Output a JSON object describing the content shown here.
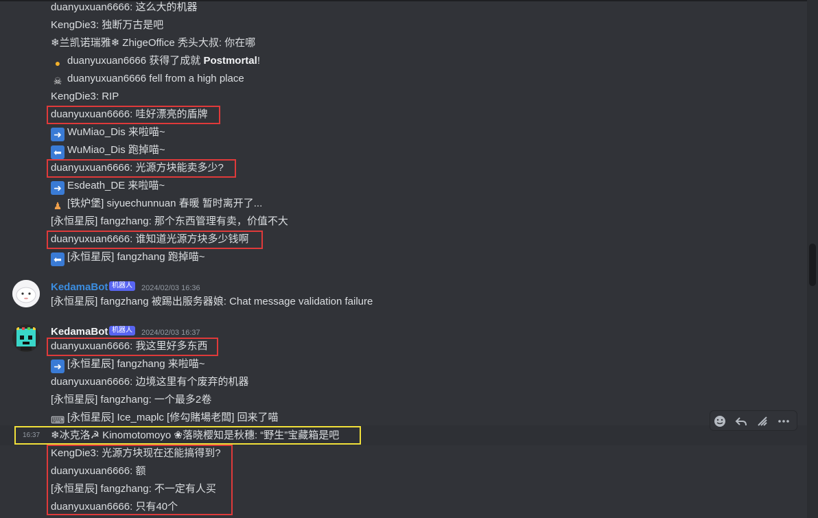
{
  "messages_top": [
    {
      "text": "duanyuxuan6666: 这么大的机器"
    },
    {
      "text": "KengDie3: 独断万古是吧"
    },
    {
      "text": "❄兰凯诺瑞雅❄ ZhigeOffice 秃头大叔: 你在哪"
    },
    {
      "icon": "medal-icon",
      "prefix": "duanyuxuan6666 获得了成就 ",
      "bold": "Postmortal",
      "suffix": "!"
    },
    {
      "icon": "skull-icon",
      "text": "duanyuxuan6666 fell from a high place"
    },
    {
      "text": "KengDie3: RIP"
    },
    {
      "text": "duanyuxuan6666: 哇好漂亮的盾牌"
    },
    {
      "icon": "join-arrow-icon",
      "text": "WuMiao_Dis 来啦喵~"
    },
    {
      "icon": "leave-arrow-icon",
      "text": "WuMiao_Dis 跑掉喵~"
    },
    {
      "text": "duanyuxuan6666: 光源方块能卖多少?"
    },
    {
      "icon": "join-arrow-icon",
      "text": "Esdeath_DE 来啦喵~"
    },
    {
      "icon": "walking-person-icon",
      "text": "[铁炉堡] siyuechunnuan 春暖 暂时离开了..."
    },
    {
      "text": "[永恒星辰] fangzhang: 那个东西管理有卖，价值不大"
    },
    {
      "text": "duanyuxuan6666: 谁知道光源方块多少钱啊"
    },
    {
      "icon": "leave-arrow-icon",
      "text": "[永恒星辰] fangzhang 跑掉喵~"
    }
  ],
  "group1": {
    "username": "KedamaBot",
    "badge": "机器人",
    "timestamp": "2024/02/03 16:36",
    "username_color": "#3b8de0",
    "message": "[永恒星辰] fangzhang 被踢出服务器娘: Chat message validation failure"
  },
  "group2": {
    "username": "KedamaBot",
    "badge": "机器人",
    "timestamp": "2024/02/03 16:37",
    "username_color": "#f2f3f5",
    "messages": [
      {
        "text": "duanyuxuan6666: 我这里好多东西"
      },
      {
        "icon": "join-arrow-icon",
        "text": "[永恒星辰] fangzhang 来啦喵~"
      },
      {
        "text": "duanyuxuan6666: 边境这里有个废弃的机器"
      },
      {
        "text": "[永恒星辰] fangzhang: 一个最多2卷"
      },
      {
        "icon": "keyboard-icon",
        "text": "[永恒星辰] Ice_maplc [修勾賭場老闆] 回来了喵"
      },
      {
        "hover_time": "16:37",
        "text": "❄冰克洛☭ Kinomotomoyo ❀落晓樱知是秋穗: “野生”宝藏箱是吧"
      },
      {
        "text": "KengDie3: 光源方块现在还能搞得到?"
      },
      {
        "text": "duanyuxuan6666: 额"
      },
      {
        "text": "[永恒星辰] fangzhang: 不一定有人买"
      },
      {
        "text": "duanyuxuan6666: 只有40个"
      }
    ]
  },
  "toolbar": {
    "buttons": [
      "add-reaction-icon",
      "reply-icon",
      "forward-icon",
      "more-icon"
    ]
  },
  "colors": {
    "background": "#313338",
    "text": "#dbdee1",
    "highlight_red": "#e03a3a",
    "highlight_yellow": "#f2e13a",
    "badge": "#5865f2"
  }
}
